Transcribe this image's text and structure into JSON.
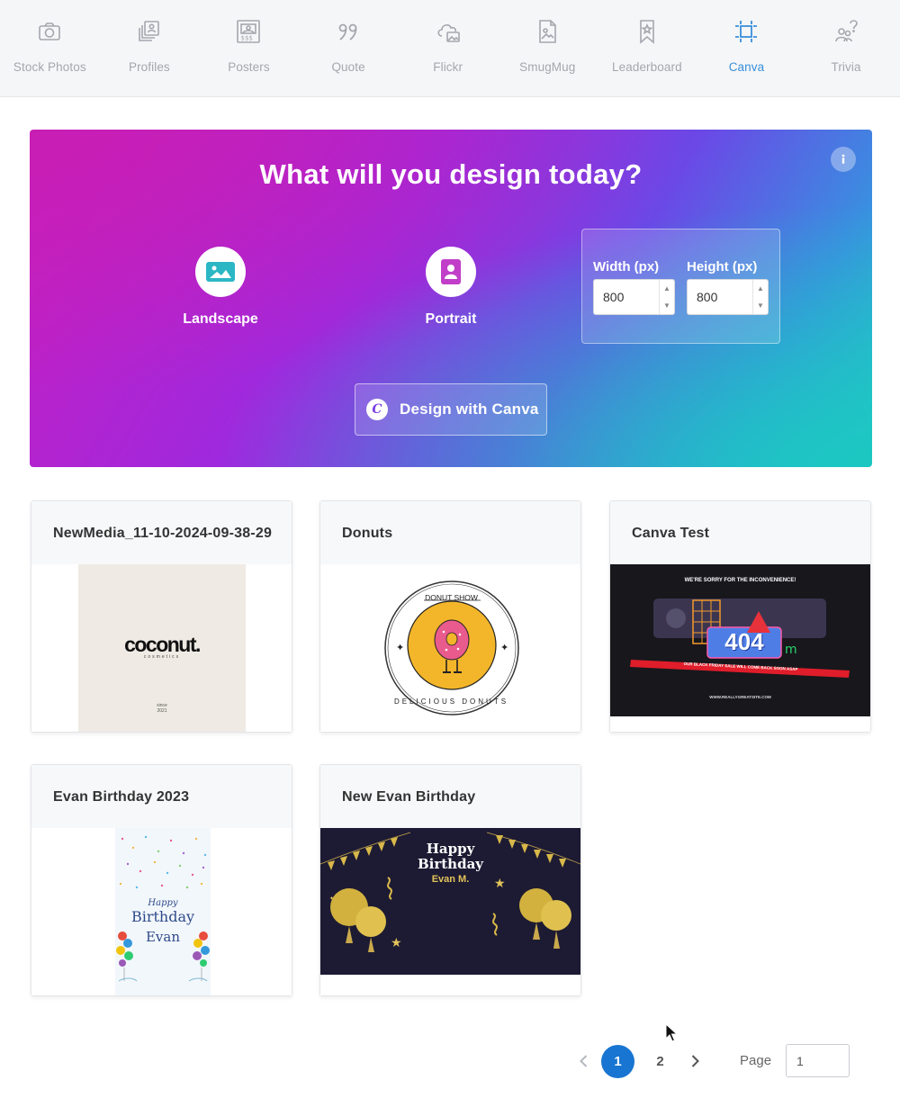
{
  "nav": {
    "items": [
      {
        "label": "Stock Photos",
        "icon": "camera-icon"
      },
      {
        "label": "Profiles",
        "icon": "profiles-icon"
      },
      {
        "label": "Posters",
        "icon": "poster-icon"
      },
      {
        "label": "Quote",
        "icon": "quote-icon"
      },
      {
        "label": "Flickr",
        "icon": "cloud-image-icon"
      },
      {
        "label": "SmugMug",
        "icon": "image-file-icon"
      },
      {
        "label": "Leaderboard",
        "icon": "bookmark-star-icon"
      },
      {
        "label": "Canva",
        "icon": "canva-frame-icon",
        "active": true
      },
      {
        "label": "Trivia",
        "icon": "trivia-icon"
      }
    ],
    "active_color": "#3a8fd9",
    "inactive_color": "#a3a7ad"
  },
  "hero": {
    "title": "What will you design today?",
    "presets": {
      "landscape": "Landscape",
      "portrait": "Portrait"
    },
    "width_label": "Width (px)",
    "height_label": "Height (px)",
    "width_value": "800",
    "height_value": "800",
    "design_button": "Design with Canva"
  },
  "designs": [
    {
      "title": "NewMedia_11-10-2024-09-38-29",
      "thumb_text": "coconut.",
      "thumb_sub": "cosmetics",
      "thumb_since": "since 2021"
    },
    {
      "title": "Donuts",
      "thumb_top": "DONUT SHOW",
      "thumb_bottom": "DELICIOUS DONUTS"
    },
    {
      "title": "Canva Test",
      "thumb_top": "WE'RE SORRY FOR THE INCONVENIENCE!",
      "thumb_code": "404",
      "thumb_banner": "OUR BLACK FRIDAY SALE WILL COME BACK SOON ASAP",
      "thumb_url": "WWW.REALLYGREATSITE.COM"
    },
    {
      "title": "Evan Birthday 2023",
      "thumb_line1": "Happy",
      "thumb_line2": "Birthday",
      "thumb_line3": "Evan"
    },
    {
      "title": "New Evan Birthday",
      "thumb_line1": "Happy",
      "thumb_line2": "Birthday",
      "thumb_line3": "Evan M."
    }
  ],
  "pagination": {
    "pages": [
      "1",
      "2"
    ],
    "current": "1",
    "page_label": "Page",
    "page_input": "1",
    "active_color": "#1875d1"
  }
}
